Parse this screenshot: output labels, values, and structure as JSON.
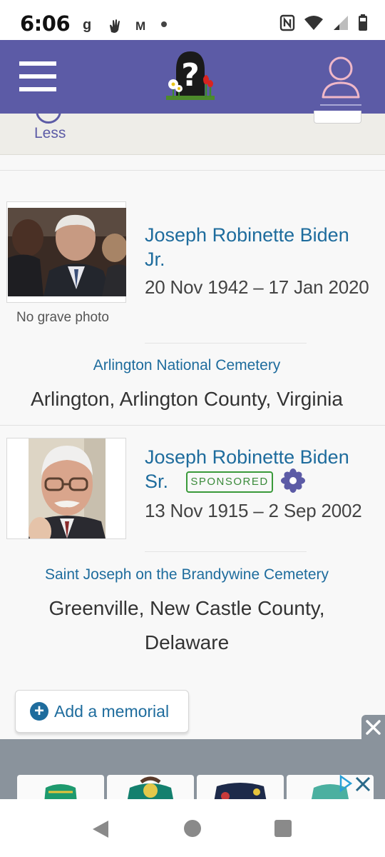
{
  "status_bar": {
    "time": "6:06",
    "notif_1": "g",
    "notif_3": "M"
  },
  "header": {
    "menu_icon": "hamburger-icon",
    "logo_icon": "question-mark-gravestone-logo",
    "profile_icon": "user-profile-icon",
    "accent_color": "#5c5ba6"
  },
  "toggle": {
    "label": "Less"
  },
  "memorials": [
    {
      "name_line1": "Joseph Robinette Biden",
      "name_line2": "Jr.",
      "dates": "20 Nov 1942 – 17 Jan 2020",
      "photo_caption": "No grave photo",
      "cemetery": "Arlington National Cemetery",
      "location": "Arlington, Arlington County, Virginia"
    },
    {
      "name_line1": "Joseph Robinette Biden",
      "name_line2": "Sr.",
      "badge": "SPONSORED",
      "badge_icon": "flower-icon",
      "dates": "13 Nov 1915 – 2 Sep 2002",
      "cemetery": "Saint Joseph on the Brandywine Cemetery",
      "location_line1": "Greenville, New Castle County,",
      "location_line2": "Delaware"
    }
  ],
  "add_memorial": {
    "label": "Add a memorial",
    "icon": "plus-circle-icon"
  },
  "ad": {
    "close_icon": "close-icon",
    "ad_choices_icon": "adchoices-icon"
  },
  "nav": {
    "back_icon": "back-triangle-icon",
    "home_icon": "home-circle-icon",
    "recents_icon": "recents-square-icon"
  },
  "colors": {
    "link_blue": "#1e6c9d",
    "sponsored_green": "#3a9a3a",
    "ad_bg": "#8a939c"
  }
}
